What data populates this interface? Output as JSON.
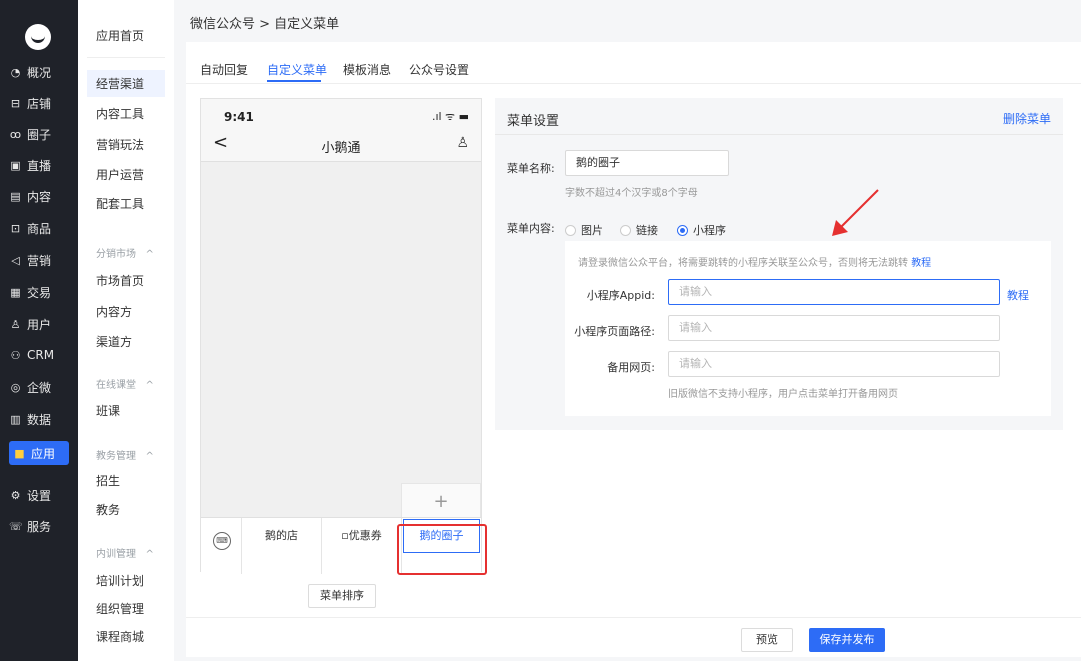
{
  "nav": {
    "items": [
      {
        "icon": "clock-icon",
        "glyph": "◔",
        "label": "概况"
      },
      {
        "icon": "store-icon",
        "glyph": "⊟",
        "label": "店铺"
      },
      {
        "icon": "circle-icon",
        "glyph": "ꝏ",
        "label": "圈子"
      },
      {
        "icon": "live-icon",
        "glyph": "▣",
        "label": "直播"
      },
      {
        "icon": "content-icon",
        "glyph": "▤",
        "label": "内容"
      },
      {
        "icon": "goods-icon",
        "glyph": "⊡",
        "label": "商品"
      },
      {
        "icon": "marketing-icon",
        "glyph": "◁",
        "label": "营销"
      },
      {
        "icon": "trade-icon",
        "glyph": "▦",
        "label": "交易"
      },
      {
        "icon": "user-icon",
        "glyph": "♙",
        "label": "用户"
      },
      {
        "icon": "crm-icon",
        "glyph": "⚇",
        "label": "CRM"
      },
      {
        "icon": "wecom-icon",
        "glyph": "◎",
        "label": "企微"
      },
      {
        "icon": "data-icon",
        "glyph": "▥",
        "label": "数据"
      },
      {
        "icon": "apps-icon",
        "glyph": "■",
        "label": "应用"
      },
      {
        "icon": "settings-icon",
        "glyph": "⚙",
        "label": "设置"
      },
      {
        "icon": "service-icon",
        "glyph": "☏",
        "label": "服务"
      }
    ]
  },
  "subnav": {
    "home": "应用首页",
    "items": [
      "经营渠道",
      "内容工具",
      "营销玩法",
      "用户运营",
      "配套工具"
    ],
    "group_distribution": "分销市场",
    "distribution": [
      "市场首页",
      "内容方",
      "渠道方"
    ],
    "group_online": "在线课堂",
    "online": [
      "班课"
    ],
    "group_edu": "教务管理",
    "edu": [
      "招生",
      "教务"
    ],
    "group_training": "内训管理",
    "training": [
      "培训计划",
      "组织管理",
      "课程商城"
    ],
    "caret": "^"
  },
  "breadcrumb": "微信公众号 > 自定义菜单",
  "tabs": [
    "自动回复",
    "自定义菜单",
    "模板消息",
    "公众号设置"
  ],
  "phone": {
    "time": "9:41",
    "status": ".ıl ᯤ ▬",
    "back": "<",
    "title": "小鹅通",
    "user_icon": "♙",
    "add": "+",
    "kbd": "⌨",
    "menus": [
      "鹅的店",
      "▫优惠券",
      "鹅的圈子"
    ]
  },
  "sort_button": "菜单排序",
  "settings": {
    "title": "菜单设置",
    "delete": "删除菜单",
    "name_label": "菜单名称:",
    "name_value": "鹅的圈子",
    "name_hint": "字数不超过4个汉字或8个字母",
    "content_label": "菜单内容:",
    "options": [
      "图片",
      "链接",
      "小程序"
    ],
    "selected_option": "小程序",
    "notice": "请登录微信公众平台，将需要跳转的小程序关联至公众号，否则将无法跳转",
    "notice_link": "教程",
    "appid_label": "小程序Appid:",
    "appid_placeholder": "请输入",
    "appid_link": "教程",
    "path_label": "小程序页面路径:",
    "path_placeholder": "请输入",
    "backup_label": "备用网页:",
    "backup_placeholder": "请输入",
    "backup_hint": "旧版微信不支持小程序，用户点击菜单打开备用网页"
  },
  "footer": {
    "preview": "预览",
    "publish": "保存并发布"
  },
  "colors": {
    "accent": "#2d6cf6",
    "sidebar": "#1f2229",
    "highlight": "#e53030"
  }
}
